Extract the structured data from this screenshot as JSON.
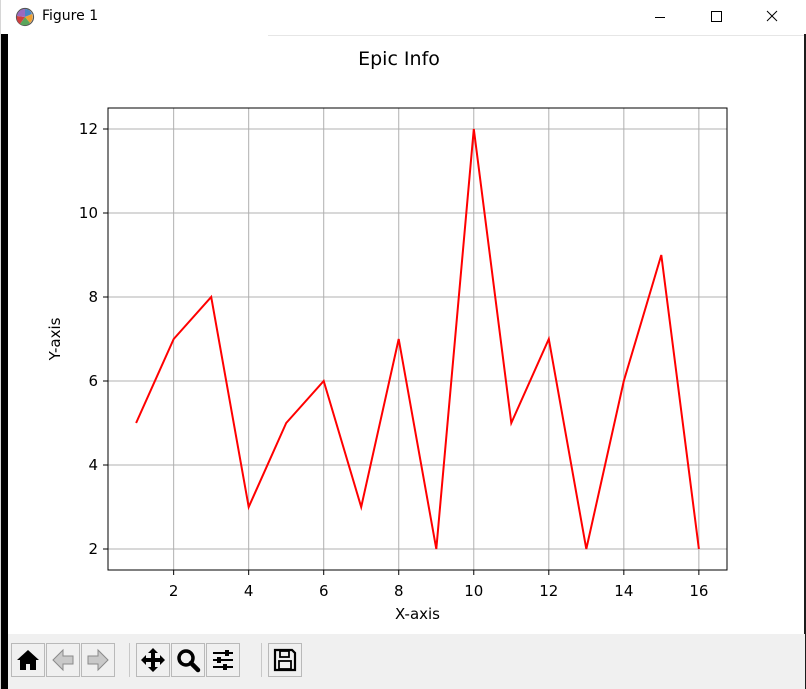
{
  "window": {
    "title": "Figure 1",
    "app_icon": "matplotlib-figure-icon",
    "controls": [
      "minimize-icon",
      "maximize-icon",
      "close-icon"
    ]
  },
  "toolbar": {
    "buttons": [
      {
        "name": "home-button",
        "icon": "home-icon"
      },
      {
        "name": "back-button",
        "icon": "arrow-left-icon"
      },
      {
        "name": "forward-button",
        "icon": "arrow-right-icon"
      },
      {
        "name": "pan-button",
        "icon": "move-icon"
      },
      {
        "name": "zoom-button",
        "icon": "magnifier-icon"
      },
      {
        "name": "subplots-button",
        "icon": "sliders-icon"
      },
      {
        "name": "save-button",
        "icon": "floppy-disk-icon"
      }
    ]
  },
  "chart_data": {
    "type": "line",
    "title": "Epic Info",
    "xlabel": "X-axis",
    "ylabel": "Y-axis",
    "x": [
      1,
      2,
      3,
      4,
      5,
      6,
      7,
      8,
      9,
      10,
      11,
      12,
      13,
      14,
      15,
      16
    ],
    "series": [
      {
        "values": [
          5,
          7,
          8,
          3,
          5,
          6,
          3,
          7,
          2,
          12,
          5,
          7,
          2,
          6,
          9,
          2
        ],
        "color": "#ff0000"
      }
    ],
    "xlim": [
      0.25,
      16.75
    ],
    "ylim": [
      1.5,
      12.5
    ],
    "xticks": [
      2,
      4,
      6,
      8,
      10,
      12,
      14,
      16
    ],
    "yticks": [
      2,
      4,
      6,
      8,
      10,
      12
    ],
    "grid": true,
    "grid_color": "#b0b0b0"
  }
}
